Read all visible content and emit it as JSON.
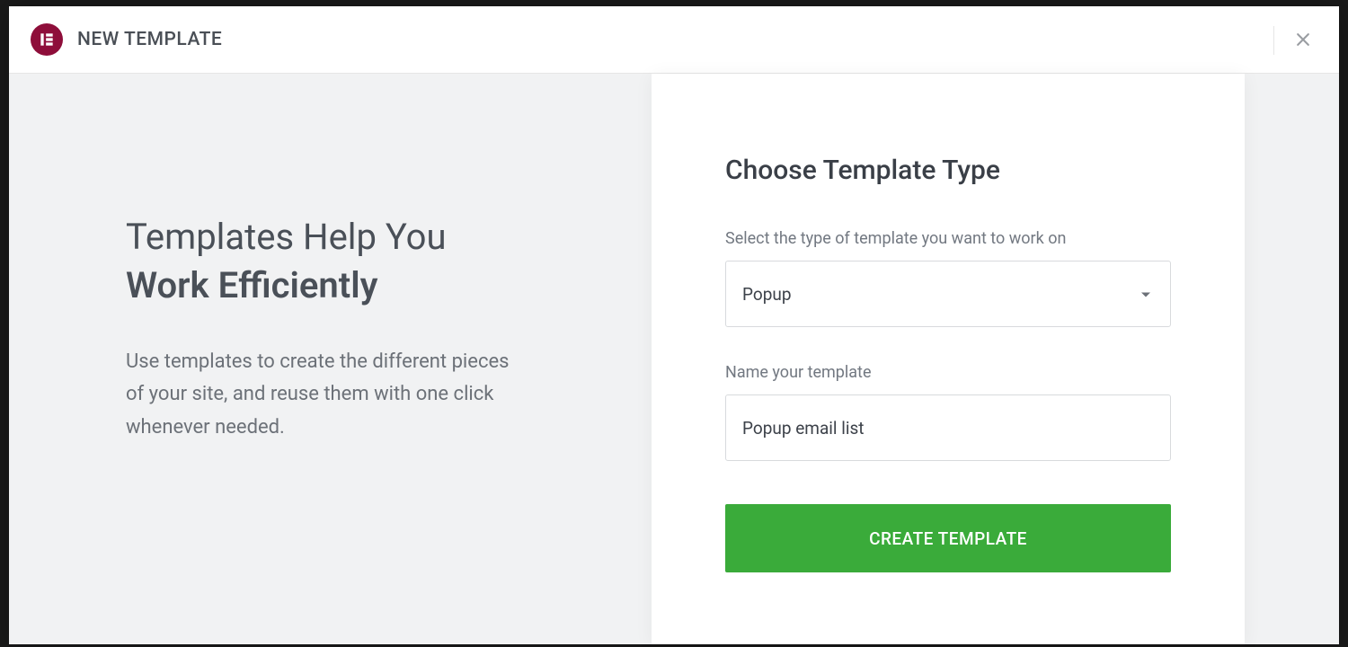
{
  "header": {
    "title": "NEW TEMPLATE"
  },
  "left": {
    "heading_line1": "Templates Help You",
    "heading_line2": "Work Efficiently",
    "description": "Use templates to create the different pieces of your site, and reuse them with one click whenever needed."
  },
  "form": {
    "title": "Choose Template Type",
    "type_label": "Select the type of template you want to work on",
    "type_value": "Popup",
    "name_label": "Name your template",
    "name_value": "Popup email list",
    "submit_label": "CREATE TEMPLATE"
  },
  "colors": {
    "brand": "#8e0e3a",
    "accent": "#3aab3a"
  }
}
